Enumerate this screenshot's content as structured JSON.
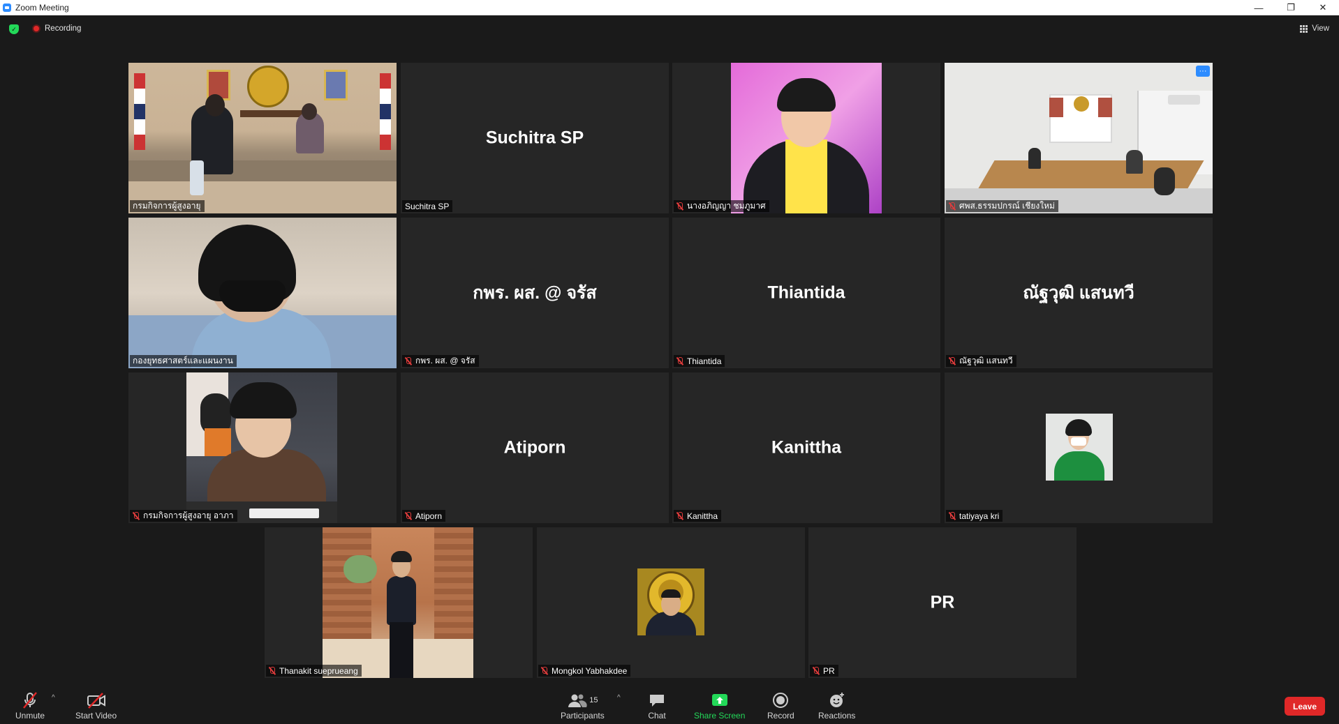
{
  "window": {
    "title": "Zoom Meeting",
    "minimize": "—",
    "restore": "❐",
    "close": "✕"
  },
  "topbar": {
    "recording_label": "Recording",
    "view_label": "View"
  },
  "tiles": [
    {
      "name": "กรมกิจการผู้สูงอายุ",
      "big": "",
      "muted": false
    },
    {
      "name": "Suchitra SP",
      "big": "Suchitra SP",
      "muted": false
    },
    {
      "name": "นางอภิญญา ชมภูมาศ",
      "big": "",
      "muted": true
    },
    {
      "name": "ศพส.ธรรมปกรณ์ เชียงใหม่",
      "big": "",
      "muted": true
    },
    {
      "name": "กองยุทธศาสตร์และแผนงาน",
      "big": "",
      "muted": false
    },
    {
      "name": "กพร. ผส. @ จรัส",
      "big": "กพร. ผส. @ จรัส",
      "muted": true
    },
    {
      "name": "Thiantida",
      "big": "Thiantida",
      "muted": true
    },
    {
      "name": "ณัฐวุฒิ แสนทวี",
      "big": "ณัฐวุฒิ แสนทวี",
      "muted": true
    },
    {
      "name": "กรมกิจการผู้สูงอายุ อาภา",
      "big": "",
      "muted": true
    },
    {
      "name": "Atiporn",
      "big": "Atiporn",
      "muted": true
    },
    {
      "name": "Kanittha",
      "big": "Kanittha",
      "muted": true
    },
    {
      "name": "tatiyaya kri",
      "big": "",
      "muted": true
    },
    {
      "name": "Thanakit sueprueang",
      "big": "",
      "muted": true
    },
    {
      "name": "Mongkol Yabhakdee",
      "big": "",
      "muted": true
    },
    {
      "name": "PR",
      "big": "PR",
      "muted": true
    }
  ],
  "toolbar": {
    "unmute": "Unmute",
    "start_video": "Start Video",
    "participants": "Participants",
    "participants_count": "15",
    "chat": "Chat",
    "share_screen": "Share Screen",
    "record": "Record",
    "reactions": "Reactions",
    "leave": "Leave"
  },
  "colors": {
    "accent": "#2d8cff",
    "share": "#23d959",
    "leave": "#e02828",
    "active_speaker": "#d6f06a"
  }
}
